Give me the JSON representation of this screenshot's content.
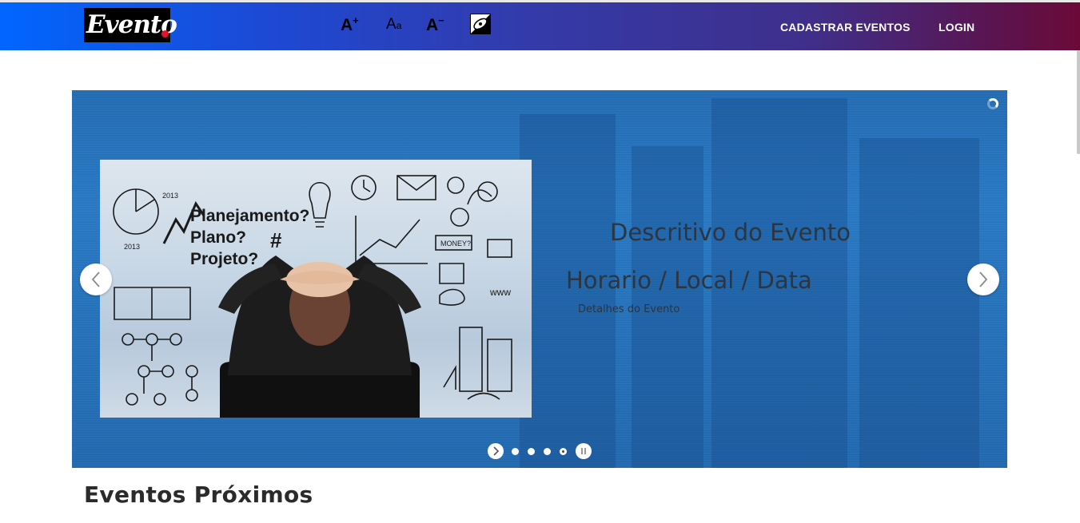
{
  "header": {
    "logo_text": "Evento",
    "accessibility": {
      "increase_label": "A",
      "increase_sup": "+",
      "reset_label": "A",
      "reset_small": "a",
      "decrease_label": "A",
      "decrease_sup": "−",
      "contrast_icon": "contrast-icon"
    },
    "nav": {
      "register_events": "CADASTRAR EVENTOS",
      "login": "LOGIN"
    },
    "gradient_colors": [
      "#0066ff",
      "#343aa8",
      "#6b0a38"
    ]
  },
  "slider": {
    "background_color": "#2878c2",
    "image_text": {
      "line1": "Planejamento?",
      "line2": "Plano?",
      "line3": "Projeto?",
      "hash": "#",
      "year1": "2013",
      "year2": "2013",
      "doodle_word": "www",
      "doodle_label": "MONEY?"
    },
    "event_description": "Descritivo do Evento",
    "event_when": "Horario / Local / Data",
    "event_details": "Detalhes do Evento",
    "total_slides": 4,
    "active_slide": 4
  },
  "main": {
    "section_title": "Eventos Próximos"
  }
}
